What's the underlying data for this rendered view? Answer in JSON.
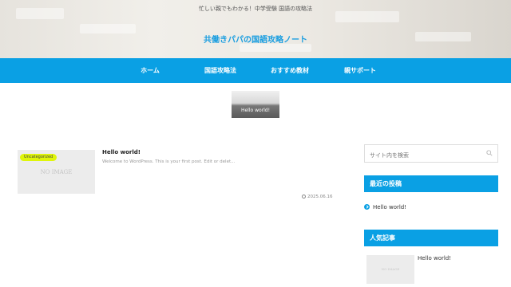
{
  "header": {
    "tagline": "忙しい親でもわかる！中学受験 国語の攻略法",
    "site_title": "共働きパパの国語攻略ノート"
  },
  "nav": {
    "items": [
      {
        "label": "ホーム"
      },
      {
        "label": "国語攻略法"
      },
      {
        "label": "おすすめ教材"
      },
      {
        "label": "親サポート"
      }
    ]
  },
  "featured": {
    "label": "Hello world!"
  },
  "post": {
    "category_badge": "Uncategorized",
    "thumbnail_text": "NO IMAGE",
    "title": "Hello world!",
    "excerpt": "Welcome to WordPress. This is your first post. Edit or delet...",
    "date": "2025.06.16"
  },
  "sidebar": {
    "search_placeholder": "サイト内を検索",
    "recent_heading": "最近の投稿",
    "recent_items": [
      {
        "label": "Hello world!"
      }
    ],
    "popular_heading": "人気記事",
    "popular_items": [
      {
        "title": "Hello world!",
        "thumbnail_text": "NO IMAGE"
      }
    ]
  },
  "colors": {
    "accent": "#0aa0e4",
    "badge": "#dff50a",
    "title": "#1b9ee0"
  }
}
